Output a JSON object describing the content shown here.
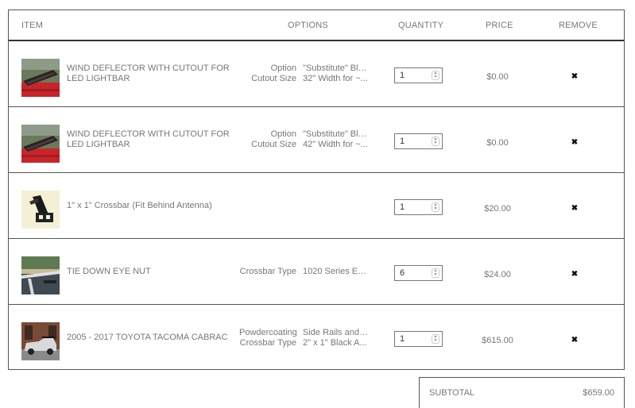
{
  "headers": {
    "item": "ITEM",
    "options": "OPTIONS",
    "quantity": "QUANTITY",
    "price": "PRICE",
    "remove": "REMOVE"
  },
  "rows": [
    {
      "name": "WIND DEFLECTOR WITH CUTOUT FOR LED LIGHTBAR",
      "image": "wind-deflector-thumbnail",
      "options": [
        {
          "label": "Option",
          "value": "\"Substitute\" Bla..."
        },
        {
          "label": "Cutout Size",
          "value": "32\" Width for ~..."
        }
      ],
      "quantity": "1",
      "price": "$0.00",
      "remove": "✖"
    },
    {
      "name": "WIND DEFLECTOR WITH CUTOUT FOR LED LIGHTBAR",
      "image": "wind-deflector-thumbnail",
      "options": [
        {
          "label": "Option",
          "value": "\"Substitute\" Bla..."
        },
        {
          "label": "Cutout Size",
          "value": "42\" Width for ~..."
        }
      ],
      "quantity": "1",
      "price": "$0.00",
      "remove": "✖"
    },
    {
      "name": "1\" x 1\" Crossbar (Fit Behind Antenna)",
      "image": "crossbar-profile-thumbnail",
      "options": [],
      "quantity": "1",
      "price": "$20.00",
      "remove": "✖"
    },
    {
      "name": "TIE DOWN EYE NUT",
      "image": "tie-down-thumbnail",
      "options": [
        {
          "label": "Crossbar Type",
          "value": "1020 Series Ex..."
        }
      ],
      "quantity": "6",
      "price": "$24.00",
      "remove": "✖"
    },
    {
      "name": "2005 - 2017 TOYOTA TACOMA CABRAC",
      "image": "toyota-tacoma-thumbnail",
      "options": [
        {
          "label": "Powdercoating",
          "value": "Side Rails and ..."
        },
        {
          "label": "Crossbar Type",
          "value": "2\" x 1\" Black A..."
        }
      ],
      "quantity": "1",
      "price": "$615.00",
      "remove": "✖"
    }
  ],
  "subtotal": {
    "label": "SUBTOTAL",
    "value": "$659.00"
  }
}
